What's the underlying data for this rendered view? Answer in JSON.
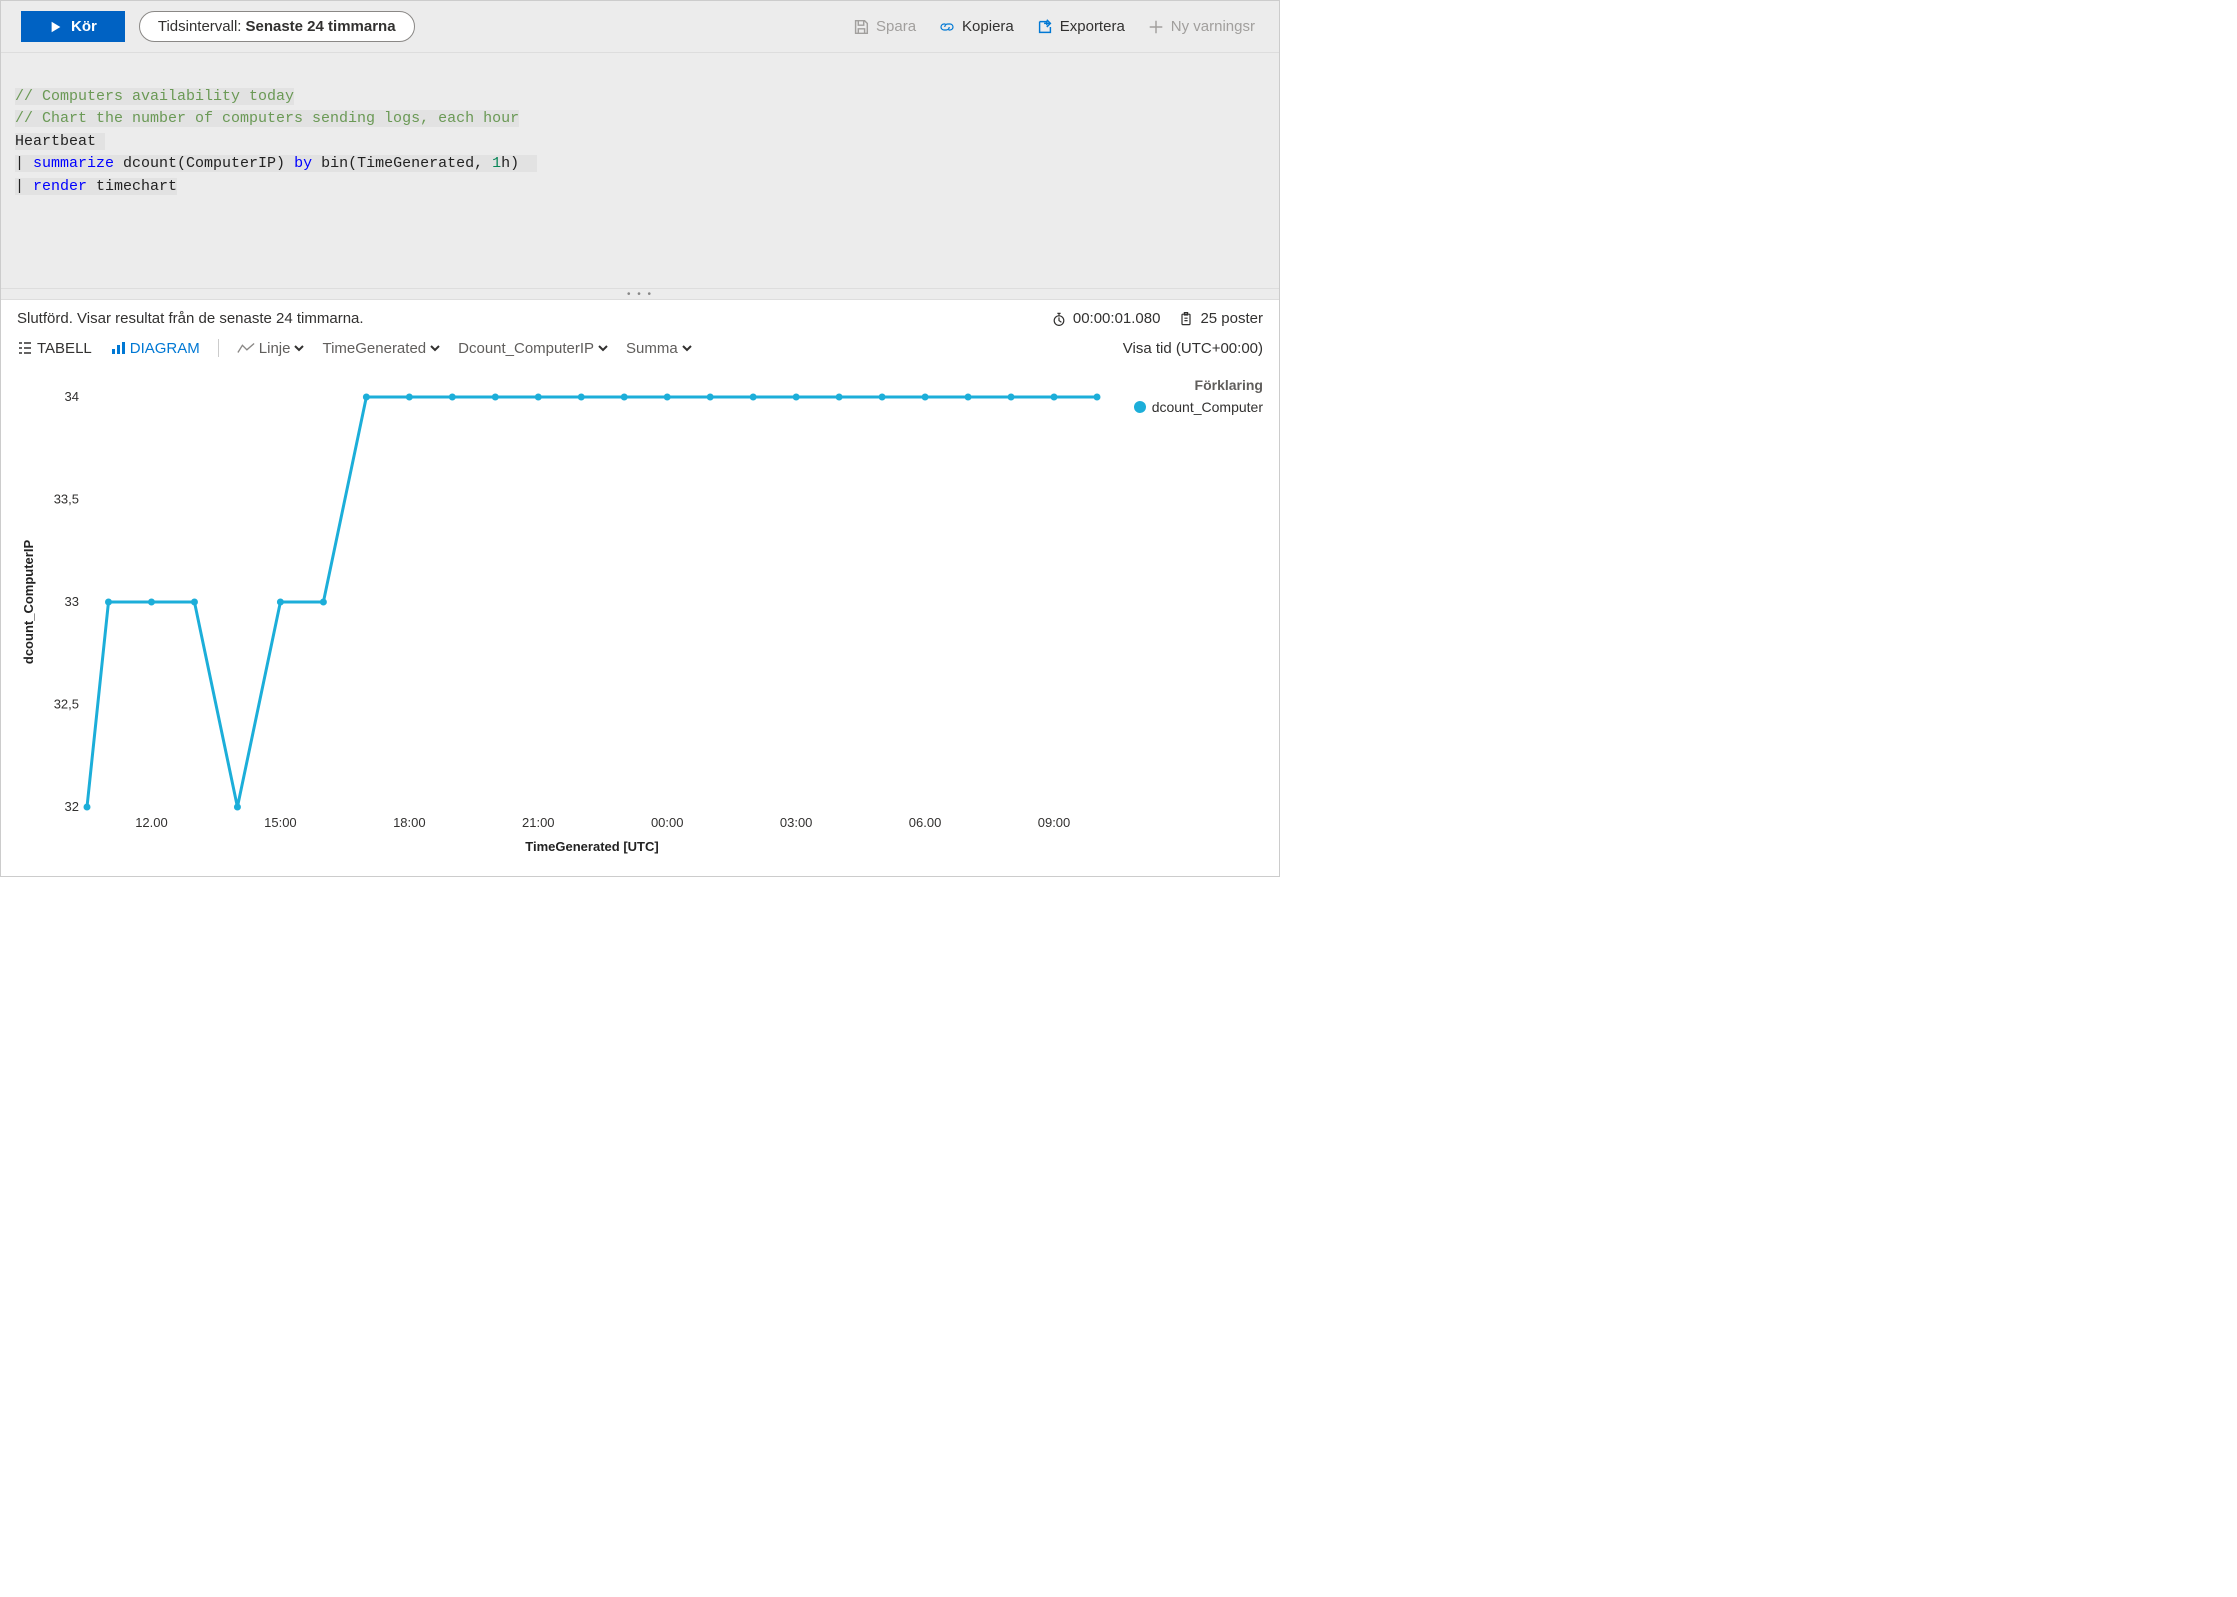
{
  "toolbar": {
    "run_label": "Kör",
    "time_range_label": "Tidsintervall:",
    "time_range_value": "Senaste 24 timmarna",
    "save": "Spara",
    "copy": "Kopiera",
    "export": "Exportera",
    "new_alert": "Ny varningsr"
  },
  "editor": {
    "line1": "// Computers availability today",
    "line2": "// Chart the number of computers sending logs, each hour",
    "line3": "Heartbeat",
    "line4_kw1": "summarize",
    "line4_mid": " dcount(ComputerIP) ",
    "line4_kw2": "by",
    "line4_end": " bin(TimeGenerated, ",
    "line4_num": "1",
    "line4_tail": "h)",
    "line5_kw": "render",
    "line5_end": " timechart"
  },
  "status": {
    "message": "Slutförd. Visar resultat från de senaste 24 timmarna.",
    "duration": "00:00:01.080",
    "records": "25 poster"
  },
  "view": {
    "tab_table": "TABELL",
    "tab_chart": "DIAGRAM",
    "chart_type": "Linje",
    "x_field": "TimeGenerated",
    "y_field": "Dcount_ComputerIP",
    "agg": "Summa",
    "timezone": "Visa tid (UTC+00:00)"
  },
  "legend": {
    "title": "Förklaring",
    "series": "dcount_Computer"
  },
  "chart_data": {
    "type": "line",
    "title": "",
    "xlabel": "TimeGenerated [UTC]",
    "ylabel": "dcount_ComputerIP",
    "ylim": [
      32,
      34
    ],
    "y_ticks": [
      32,
      32.5,
      33,
      33.5,
      34
    ],
    "y_tick_labels": [
      "32",
      "32,5",
      "33",
      "33,5",
      "34"
    ],
    "x_tick_labels": [
      "12.00",
      "15:00",
      "18:00",
      "21:00",
      "00:00",
      "03:00",
      "06.00",
      "09:00"
    ],
    "x_tick_hours": [
      12,
      15,
      18,
      21,
      24,
      27,
      30,
      33
    ],
    "series": [
      {
        "name": "dcount_Computer",
        "color": "#1caed9",
        "x_hours": [
          10.5,
          11,
          12,
          13,
          14,
          15,
          16,
          17,
          18,
          19,
          20,
          21,
          22,
          23,
          24,
          25,
          26,
          27,
          28,
          29,
          30,
          31,
          32,
          33,
          34
        ],
        "y": [
          32,
          33,
          33,
          33,
          32,
          33,
          33,
          34,
          34,
          34,
          34,
          34,
          34,
          34,
          34,
          34,
          34,
          34,
          34,
          34,
          34,
          34,
          34,
          34,
          34
        ]
      }
    ],
    "x_range": [
      10.5,
      34
    ]
  }
}
